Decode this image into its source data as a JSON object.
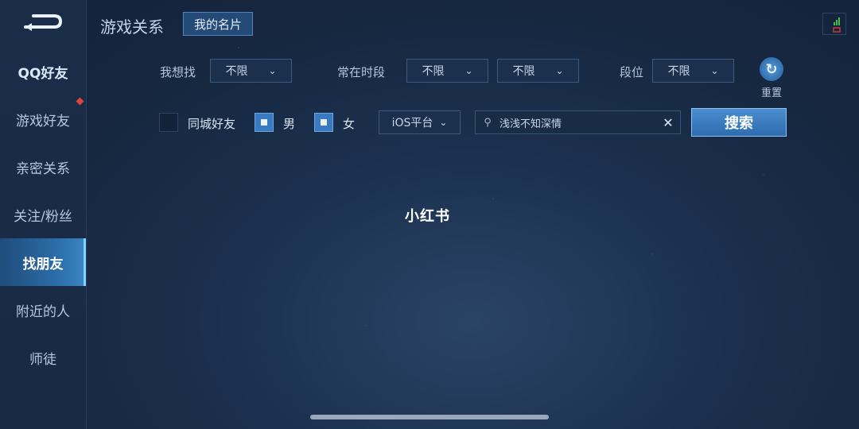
{
  "sidebar": {
    "items": [
      {
        "label": "QQ好友"
      },
      {
        "label": "游戏好友"
      },
      {
        "label": "亲密关系"
      },
      {
        "label": "关注/粉丝"
      },
      {
        "label": "找朋友"
      },
      {
        "label": "附近的人"
      },
      {
        "label": "师徒"
      }
    ],
    "active": "找朋友",
    "badge_color": "#e0453a"
  },
  "header": {
    "title": "游戏关系",
    "card_button": "我的名片"
  },
  "filters": {
    "seeking_label": "我想找",
    "seeking_value": "不限",
    "active_time_label": "常在时段",
    "active_time_from": "不限",
    "active_time_to": "不限",
    "rank_label": "段位",
    "rank_value": "不限",
    "reset_label": "重置",
    "same_city_label": "同城好友",
    "same_city_checked": false,
    "male_label": "男",
    "male_checked": true,
    "female_label": "女",
    "female_checked": true,
    "platform_value": "iOS平台",
    "search_value": "浅浅不知深情",
    "search_button": "搜索"
  },
  "watermark": "小红书",
  "icons": {
    "back": "back-arrow-icon",
    "reset": "refresh-icon",
    "search": "search-icon",
    "clear": "close-icon",
    "chevron": "chevron-down-icon",
    "signal": "signal-icon"
  },
  "colors": {
    "accent": "#3a7ac0",
    "active_nav": "#2a6aa4",
    "background": "#1c3150"
  }
}
